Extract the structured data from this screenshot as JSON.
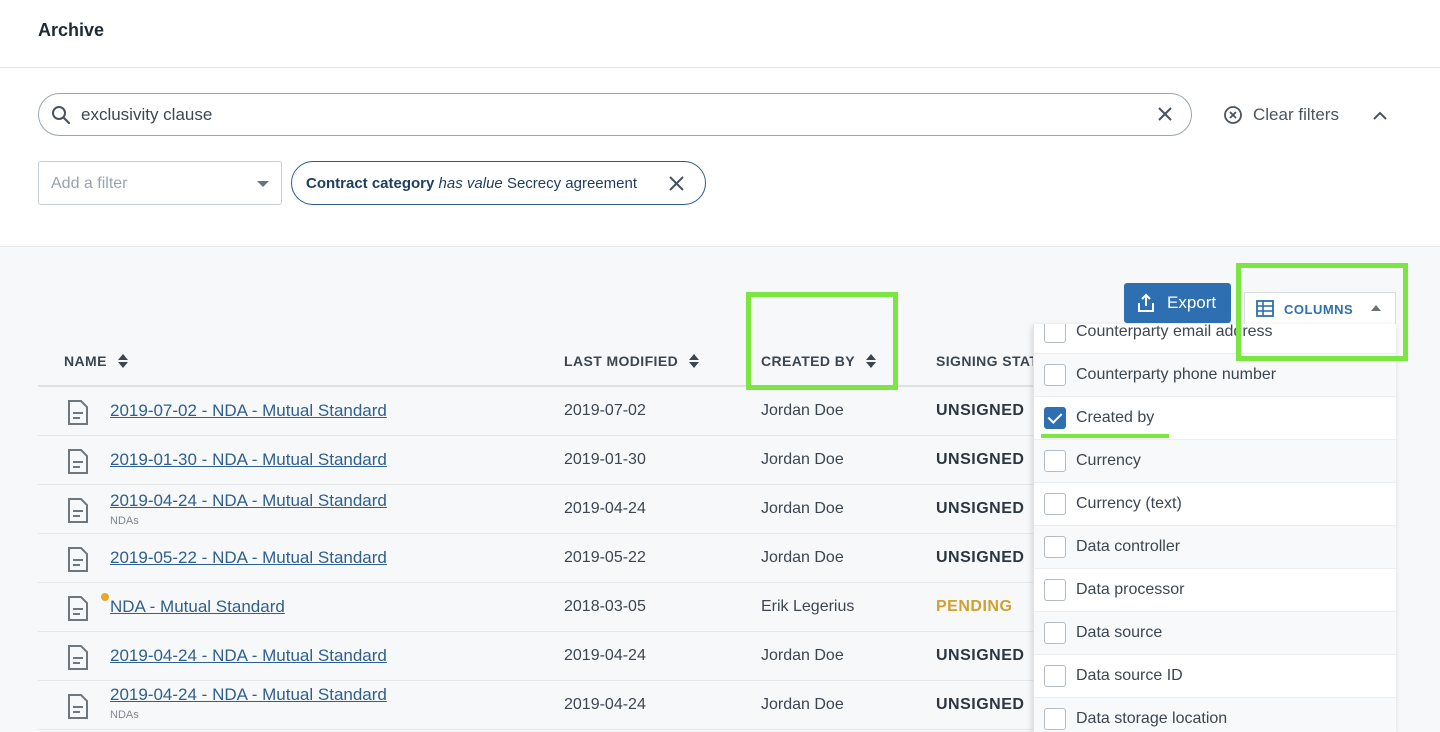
{
  "header": {
    "title": "Archive"
  },
  "search": {
    "value": "exclusivity clause"
  },
  "filters": {
    "clear_label": "Clear filters",
    "add_filter_placeholder": "Add a filter",
    "chip": {
      "field": "Contract category",
      "operator": "has value",
      "value": "Secrecy agreement"
    }
  },
  "toolbar": {
    "export_label": "Export",
    "columns_label": "COLUMNS"
  },
  "table": {
    "columns": [
      "NAME",
      "LAST MODIFIED",
      "CREATED BY",
      "SIGNING STAT"
    ],
    "rows": [
      {
        "name": "2019-07-02 - NDA - Mutual Standard",
        "sub": "",
        "modified": "2019-07-02",
        "created_by": "Jordan Doe",
        "status": "UNSIGNED"
      },
      {
        "name": "2019-01-30 - NDA - Mutual Standard",
        "sub": "",
        "modified": "2019-01-30",
        "created_by": "Jordan Doe",
        "status": "UNSIGNED"
      },
      {
        "name": "2019-04-24 - NDA - Mutual Standard",
        "sub": "NDAs",
        "modified": "2019-04-24",
        "created_by": "Jordan Doe",
        "status": "UNSIGNED"
      },
      {
        "name": "2019-05-22 - NDA - Mutual Standard",
        "sub": "",
        "modified": "2019-05-22",
        "created_by": "Jordan Doe",
        "status": "UNSIGNED"
      },
      {
        "name": "NDA - Mutual Standard",
        "sub": "",
        "modified": "2018-03-05",
        "created_by": "Erik Legerius",
        "status": "PENDING"
      },
      {
        "name": "2019-04-24 - NDA - Mutual Standard",
        "sub": "",
        "modified": "2019-04-24",
        "created_by": "Jordan Doe",
        "status": "UNSIGNED"
      },
      {
        "name": "2019-04-24 - NDA - Mutual Standard",
        "sub": "NDAs",
        "modified": "2019-04-24",
        "created_by": "Jordan Doe",
        "status": "UNSIGNED"
      }
    ]
  },
  "column_options": [
    {
      "label": "Counterparty email address",
      "checked": false
    },
    {
      "label": "Counterparty phone number",
      "checked": false
    },
    {
      "label": "Created by",
      "checked": true
    },
    {
      "label": "Currency",
      "checked": false
    },
    {
      "label": "Currency (text)",
      "checked": false
    },
    {
      "label": "Data controller",
      "checked": false
    },
    {
      "label": "Data processor",
      "checked": false
    },
    {
      "label": "Data source",
      "checked": false
    },
    {
      "label": "Data source ID",
      "checked": false
    },
    {
      "label": "Data storage location",
      "checked": false
    }
  ],
  "colors": {
    "accent": "#2e6fb2",
    "link": "#2e5f8f",
    "pending": "#d1a02e",
    "highlight": "#7be642"
  },
  "icons": [
    "search-icon",
    "close-icon",
    "clear-circle-icon",
    "chevron-up-icon",
    "export-icon",
    "table-grid-icon",
    "document-icon",
    "sort-icon"
  ]
}
